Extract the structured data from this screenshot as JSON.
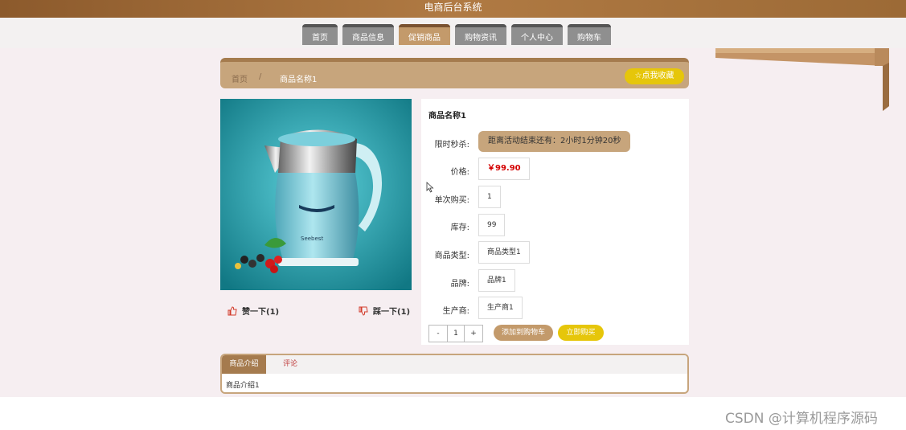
{
  "header": {
    "title": "电商后台系统"
  },
  "nav": {
    "items": [
      {
        "label": "首页",
        "active": false
      },
      {
        "label": "商品信息",
        "active": false
      },
      {
        "label": "促销商品",
        "active": true
      },
      {
        "label": "购物资讯",
        "active": false
      },
      {
        "label": "个人中心",
        "active": false
      },
      {
        "label": "购物车",
        "active": false
      }
    ]
  },
  "breadcrumb": {
    "home": "首页",
    "separator": "/",
    "current": "商品名称1",
    "favorite_label": "☆点我收藏"
  },
  "product": {
    "name": "商品名称1",
    "flash_sale_label": "限时秒杀:",
    "flash_sale_value": "距离活动结束还有：2小时1分钟20秒",
    "price_label": "价格:",
    "price_value": "￥99.90",
    "min_purchase_label": "单次购买:",
    "min_purchase_value": "1",
    "stock_label": "库存:",
    "stock_value": "99",
    "category_label": "商品类型:",
    "category_value": "商品类型1",
    "brand_label": "品牌:",
    "brand_value": "品牌1",
    "manufacturer_label": "生产商:",
    "manufacturer_value": "生产商1",
    "quantity": "1",
    "decrement": "-",
    "increment": "+",
    "add_to_cart_label": "添加到购物车",
    "buy_now_label": "立即购买",
    "image_brand_text": "Seebest"
  },
  "votes": {
    "like_label": "赞一下(1)",
    "dislike_label": "踩一下(1)"
  },
  "tabs": {
    "intro_label": "商品介绍",
    "comment_label": "评论",
    "intro_content": "商品介绍1"
  },
  "watermark": "CSDN @计算机程序源码",
  "colors": {
    "brand_brown": "#a57b4e",
    "accent_yellow": "#e6c60a",
    "price_red": "#d40000",
    "tan": "#c7a57c"
  },
  "icons": {
    "like": "thumbs-up-icon",
    "dislike": "thumbs-down-icon",
    "favorite": "star-icon",
    "cursor": "mouse-pointer-icon"
  }
}
